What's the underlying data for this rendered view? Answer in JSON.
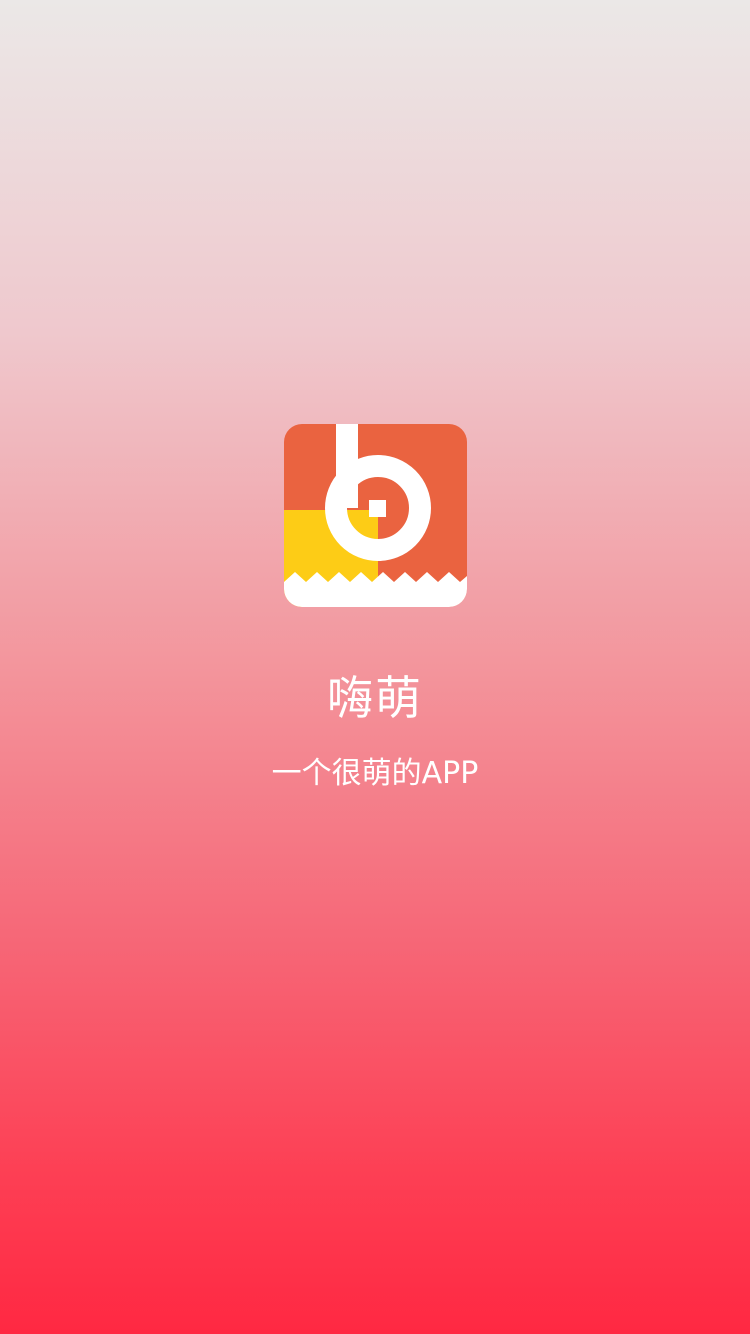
{
  "splash": {
    "app_name": "嗨萌",
    "tagline": "一个很萌的APP"
  },
  "logo": {
    "icon": "number-six-icon",
    "colors": {
      "orange": "#ea6340",
      "yellow": "#fdcc16",
      "white": "#ffffff"
    }
  },
  "theme": {
    "gradient_top": "#ebe8e7",
    "gradient_bottom": "#ff2842",
    "text_color": "#ffffff"
  }
}
